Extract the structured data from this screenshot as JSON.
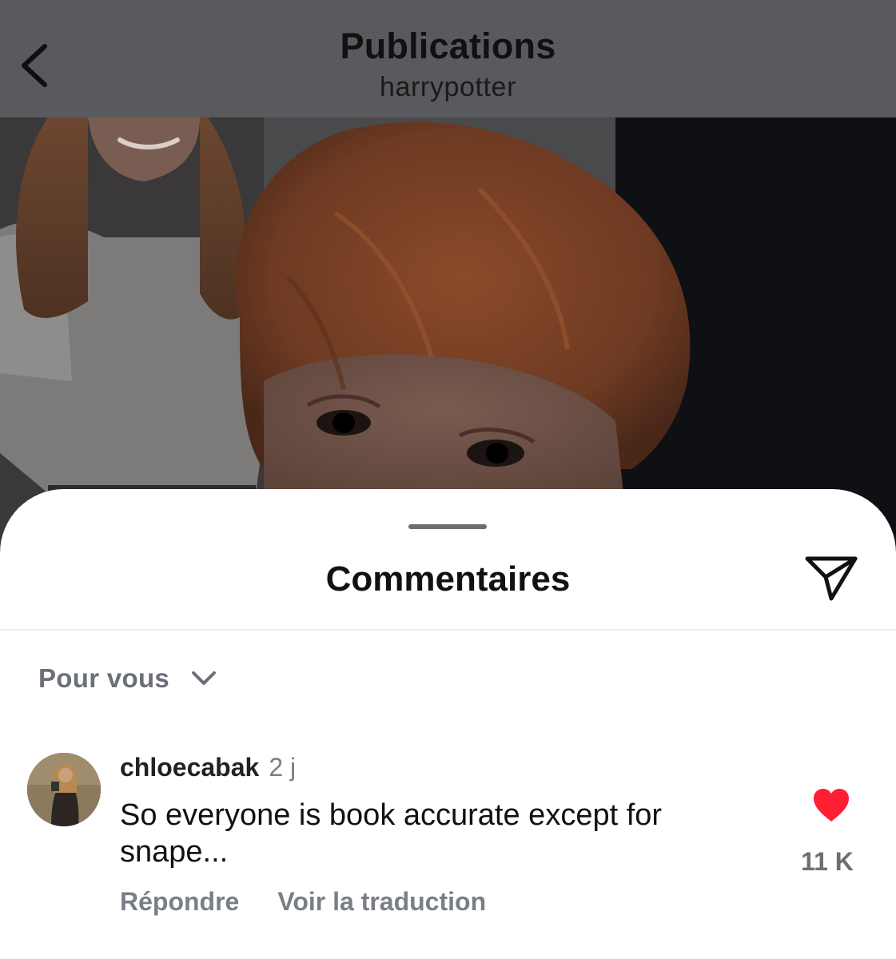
{
  "header": {
    "title": "Publications",
    "subtitle": "harrypotter",
    "back_icon": "chevron-left-icon"
  },
  "post": {
    "image_description": "photo"
  },
  "comments_sheet": {
    "title": "Commentaires",
    "share_icon": "send-icon",
    "sort": {
      "label": "Pour vous",
      "icon": "chevron-down-icon"
    },
    "comments": [
      {
        "username": "chloecabak",
        "time": "2 j",
        "text": "So everyone is book accurate except for snape...",
        "reply_label": "Répondre",
        "translate_label": "Voir la traduction",
        "like_icon": "heart-filled-icon",
        "like_count": "11 K",
        "liked": true
      }
    ]
  },
  "colors": {
    "header_overlay": "#595a5e",
    "like_red": "#ff1f33",
    "muted_text": "#7a7e86"
  }
}
